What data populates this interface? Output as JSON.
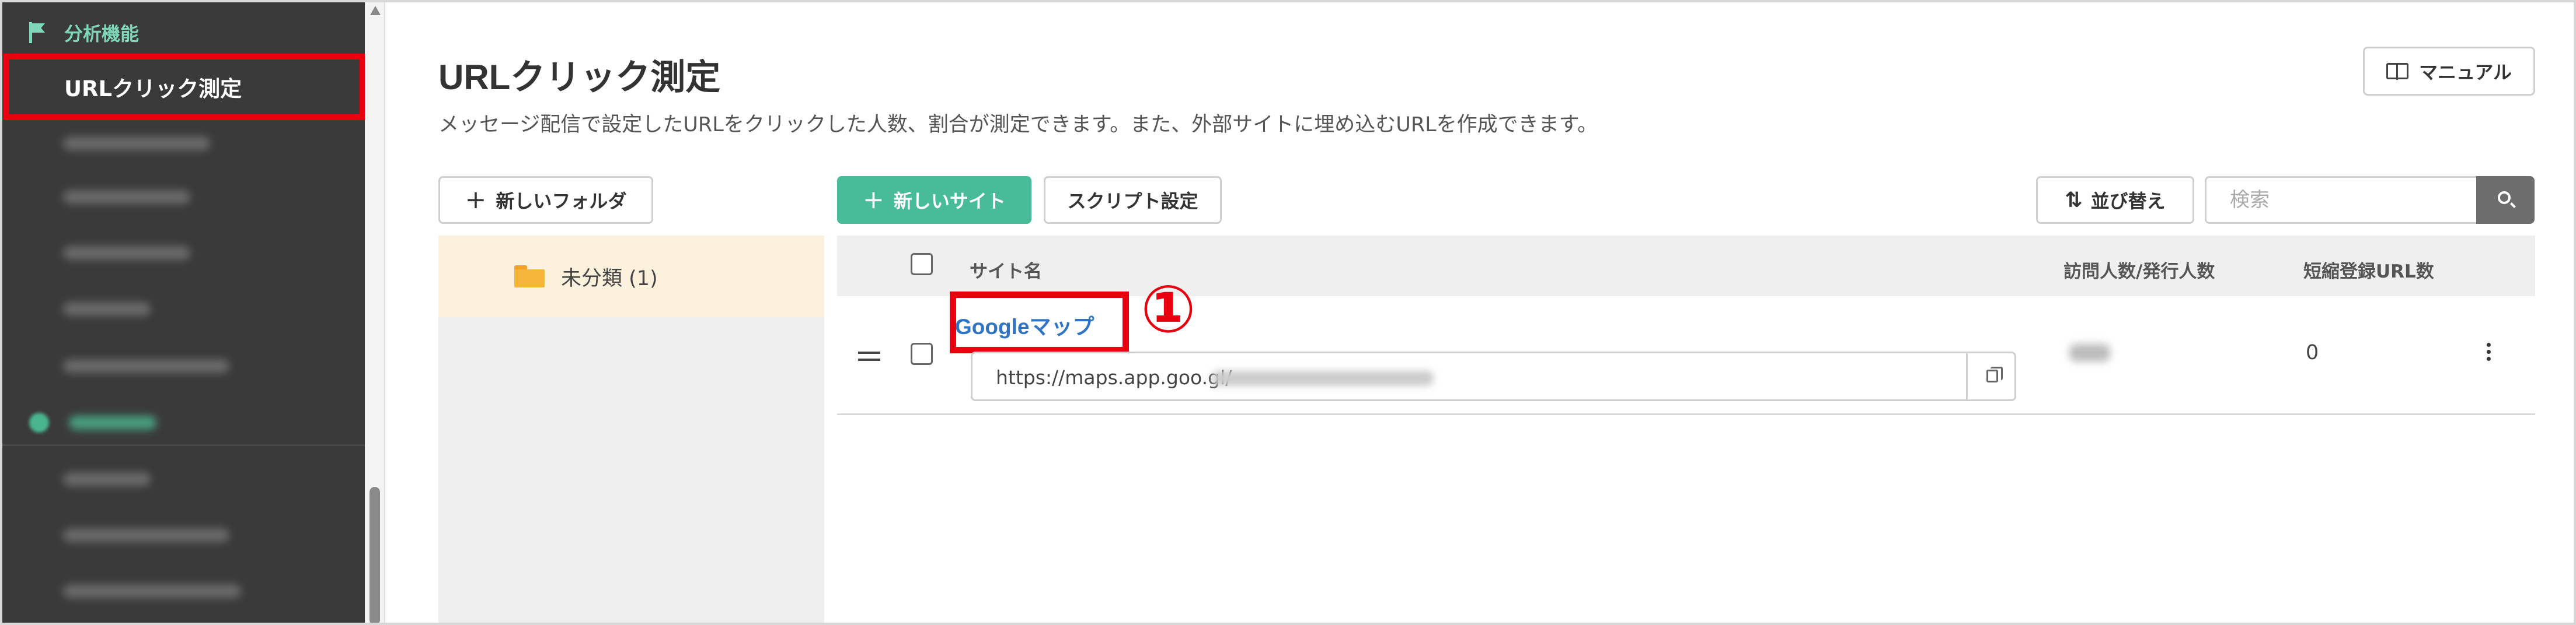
{
  "sidebar": {
    "section_title": "分析機能",
    "active_item": "URLクリック測定",
    "blurred_items": [
      "",
      "",
      "",
      "",
      ""
    ],
    "blurred_items_2": [
      "",
      "",
      ""
    ]
  },
  "header": {
    "title": "URLクリック測定",
    "description": "メッセージ配信で設定したURLをクリックした人数、割合が測定できます。また、外部サイトに埋め込むURLを作成できます。",
    "manual_label": "マニュアル"
  },
  "toolbar": {
    "new_folder_label": "新しいフォルダ",
    "new_site_label": "新しいサイト",
    "script_settings_label": "スクリプト設定",
    "sort_label": "並び替え",
    "search_placeholder": "検索"
  },
  "folders": [
    {
      "label": "未分類 (1)"
    }
  ],
  "table": {
    "columns": {
      "site_name": "サイト名",
      "visitors": "訪問人数/発行人数",
      "short_urls": "短縮登録URL数"
    },
    "rows": [
      {
        "site_name": "Googleマップ",
        "url": "https://maps.app.goo.gl/",
        "short_url_count": "0"
      }
    ]
  },
  "annotation": {
    "step_marker": "①"
  },
  "colors": {
    "sidebar_bg": "#3a3a3a",
    "accent_green": "#48bc98",
    "highlight_red": "#e8000f",
    "link_blue": "#2f75c4",
    "folder_selected_bg": "#fcf1dc"
  }
}
